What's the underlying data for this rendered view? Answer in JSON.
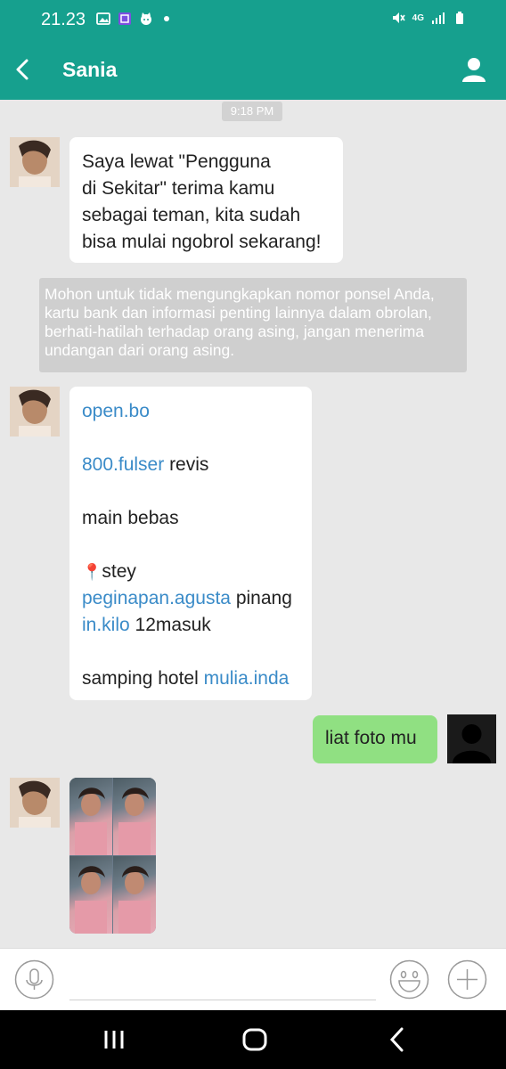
{
  "status_bar": {
    "time": "21.23",
    "network": "4G",
    "icons": [
      "gallery-icon",
      "app-icon",
      "cat-icon",
      "notification-dot",
      "mute-icon",
      "signal-icon",
      "battery-icon"
    ]
  },
  "header": {
    "title": "Sania",
    "color": "#16a08e",
    "back_icon": "back-arrow-icon",
    "profile_icon": "person-icon"
  },
  "conversation": {
    "timestamp": "9:18 PM",
    "incoming_1": {
      "lines": [
        "Saya lewat \"Pengguna",
        "di Sekitar\" terima kamu",
        "sebagai teman, kita sudah",
        "bisa mulai ngobrol sekarang!"
      ]
    },
    "notice": "Mohon untuk tidak  mengungkapkan nomor ponsel Anda, kartu bank dan informasi penting lainnya dalam obrolan, berhati-hatilah terhadap orang asing, jangan menerima undangan dari orang asing.",
    "incoming_2": {
      "line1_link": "open.bo",
      "line2_link": "800.fulser",
      "line2_text": " revis",
      "line3": "main bebas",
      "line4_pin": "📍",
      "line4_text": "stey",
      "line5_link": "peginapan.agusta",
      "line5_text": " pinang",
      "line6_link": "in.kilo",
      "line6_text": " 12masuk",
      "line7_text": "samping hotel ",
      "line7_link": "mulia.inda"
    },
    "outgoing_1": {
      "text": "liat foto mu"
    },
    "incoming_photo": {
      "kind": "image"
    }
  },
  "composer": {
    "placeholder": "",
    "icons": [
      "microphone-icon",
      "smiley-icon",
      "plus-icon"
    ]
  },
  "nav_bar": {
    "icons": [
      "recent-apps-icon",
      "home-icon",
      "back-icon"
    ]
  },
  "colors": {
    "accent": "#16a08e",
    "sent_bubble": "#90e082",
    "link": "#3a8bc8",
    "background": "#e8e8e8"
  }
}
